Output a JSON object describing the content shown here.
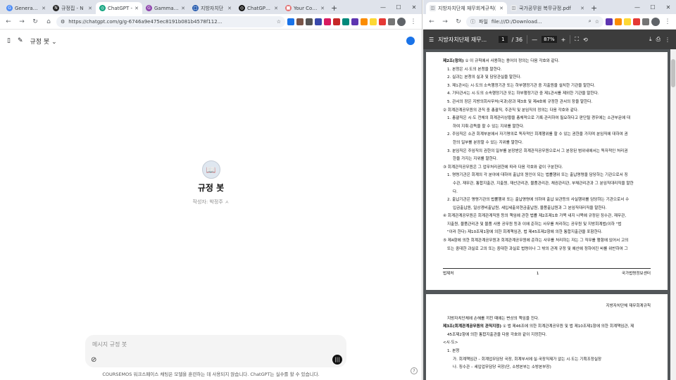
{
  "left_window": {
    "tabs": [
      {
        "title": "Generative",
        "color": "#4c8bf5",
        "glyph": "G"
      },
      {
        "title": "규정집 - N",
        "color": "#222222",
        "glyph": "N"
      },
      {
        "title": "ChatGPT -",
        "color": "#10a37f",
        "glyph": "◎",
        "active": true
      },
      {
        "title": "Gammas -",
        "color": "#8e44ad",
        "glyph": "G"
      },
      {
        "title": "지방자치단",
        "color": "#2b5fb0",
        "glyph": "□"
      },
      {
        "title": "ChatGPT 나",
        "color": "#111111",
        "glyph": "◎"
      },
      {
        "title": "Your Comp",
        "color": "#e57373",
        "glyph": "■"
      }
    ],
    "url": "https://chatgpt.com/g/g-6746a9e475ec8191b081b4578f112...",
    "header_title": "규정 봇",
    "gpt_name": "규정 봇",
    "gpt_author": "작성자: 박정주 ㅅ",
    "composer_placeholder": "메시지 규정 봇",
    "disclaimer": "COURSEMOS 워크스페이스 채팅은 모델을 훈련하는 데 사용되지 않습니다. ChatGPT는 실수를 할 수 있습니다.",
    "help": "?"
  },
  "right_window": {
    "tabs": [
      {
        "title": "지방자치단체 재무회계규칙(",
        "active": true
      },
      {
        "title": "국가공무원 복무규정.pdf"
      }
    ],
    "url_prefix": "파일",
    "url": "file:///D:/Download...",
    "pdf_title": "지방자치단체 재무...",
    "page_current": "1",
    "page_total": "/ 36",
    "zoom": "87%",
    "page1_lines": [
      {
        "cls": "",
        "html": "<b>제2조(정의)</b> ① 이 규칙에서 사용하는 용어의 정의는 다음 각호와 같다."
      },
      {
        "cls": "ind",
        "html": "1. 본청은 시·도의 본청을 말한다."
      },
      {
        "cls": "ind",
        "html": "2. 실과는 본청의 실과 및 담당관실을 말한다."
      },
      {
        "cls": "ind",
        "html": "3. 제1관서는 시·도의 소속행정기관 또는 하부행정기관 중 지출원을 설치한 기관을 말한다."
      },
      {
        "cls": "ind",
        "html": "4. 기타관서는 시·도의 소속행정기관 또는 하부행정기관 중 제1관서를 제외한 기관을 말한다."
      },
      {
        "cls": "ind",
        "html": "5. 관서의 장은 지방의회사무처(국과)장과 제3호 및 제4호에 규정한 관서의 장을 말한다."
      },
      {
        "cls": "",
        "html": "② 회계관계공무원의 관직 중 총괄직, 주관직 및 분임직의 정의는 다음 각호와 같다."
      },
      {
        "cls": "ind",
        "html": "1. 총괄직은 시·도 전체의 회계관리상황을 총체적으로 기록·관리하여 필요하다고 판단될 경우에는 소관부문에 대"
      },
      {
        "cls": "ind2",
        "html": "하여 지휘·감독을 할 수 있는 지위를 말한다."
      },
      {
        "cls": "ind",
        "html": "2. 주임직은 소관 회계부분에서 자기명의로 독자적인 회계행위를 할 수 있는 권한을 가지며 분임직에 대하여 권"
      },
      {
        "cls": "ind2",
        "html": "한의 일부를 분장할 수 있는 지위를 말한다."
      },
      {
        "cls": "ind",
        "html": "3. 분임직은 주임직의 권한의 일부를 분장받은 회계관직공무원으로서 그 분장된 범위내에서는 독자적인 처리권"
      },
      {
        "cls": "ind2",
        "html": "한을 가지는 지위를 말한다."
      },
      {
        "cls": "",
        "html": "③ 회계관직공무원은 그 업무처리권한에 따라 다음 각호와 같이 구분한다."
      },
      {
        "cls": "ind",
        "html": "1. 명령기관은 회계의 각 분야에 대하여 출납의 원인이 되는 법률행위 또는 출납명령을 담당하는 기관으로서 징"
      },
      {
        "cls": "ind2",
        "html": "수관, 재무관, 통합지출관, 지출원, 재산관리관, 물품관리관, 채권관리관, 부채관리관과 그 분임직대리직을 말한"
      },
      {
        "cls": "ind2",
        "html": "다."
      },
      {
        "cls": "ind",
        "html": "2. 출납기관은 명령기관의 법률행위 또는 출납명령에 의하여 출납 보관등의 사실행위를 담당하는 기관으로서 수"
      },
      {
        "cls": "ind2",
        "html": "입금출납원, 일상경비출납원, 세입세출외현금출납원, 물품출납원과 그 분임직대리직을 말한다."
      },
      {
        "cls": "",
        "html": "④ 회계관계공무원은 회계관계직원 등의 책임에 관한 법률 제2조제1호 가목 내지 나목에 규정된 징수관, 재무관,"
      },
      {
        "cls": "ind",
        "html": "지출원, 물품관리관 및 물품 사용 공무원 등과 이에 준하는 사무를 처리하는 공무원 및 지방회계법(이하 \"법"
      },
      {
        "cls": "ind",
        "html": "\"이라 한다) 제10조제1항에 의한 회계책임관, 법 제45조제2항에 의한 통합지출관을 포함한다."
      },
      {
        "cls": "",
        "html": "⑤ 제4항에 의한 회계관계공무원과 회계관계공무원에 준하는 사무를 처리하는 자는 그 직무를 행함에 있어서 고의"
      },
      {
        "cls": "ind",
        "html": "또는 중대한 과실로 고의 또는 중대한 과실로 법령이나 그 밖의 관계 규정 및 예산에 정하여진 바를 위반하여 그"
      }
    ],
    "footer": {
      "left": "법제처",
      "center": "1",
      "right": "국가법령정보센터"
    },
    "page2_header": "지방자치단체 재무회계규칙",
    "page2_lines": [
      {
        "cls": "ind",
        "html": "지방자치단체에 손해를 끼친 때에는 변상의 책임을 진다."
      },
      {
        "cls": "",
        "html": "<b>제3조(회계관계공무원의 관직지정)</b> ① 법 제46조에 의한 회계관계공무원 및 법 제10조제1항에 의한 회계책임관, 제"
      },
      {
        "cls": "ind",
        "html": "45조제2항에 의한 통합지출관을 다음 각호와 같이 지정한다."
      },
      {
        "cls": "",
        "html": "&lt;시·도&gt;"
      },
      {
        "cls": "ind",
        "html": "1. 본청"
      },
      {
        "cls": "ind2",
        "html": "가. 회계책임관 – 회계업무담당 국장, 회계부서에 실·국장직제가 없는 시·도는 기획조정실장"
      },
      {
        "cls": "ind2",
        "html": "나. 징수관 – 세입업무담당 국장(단, 소방본부는 소방본부장)"
      }
    ]
  }
}
